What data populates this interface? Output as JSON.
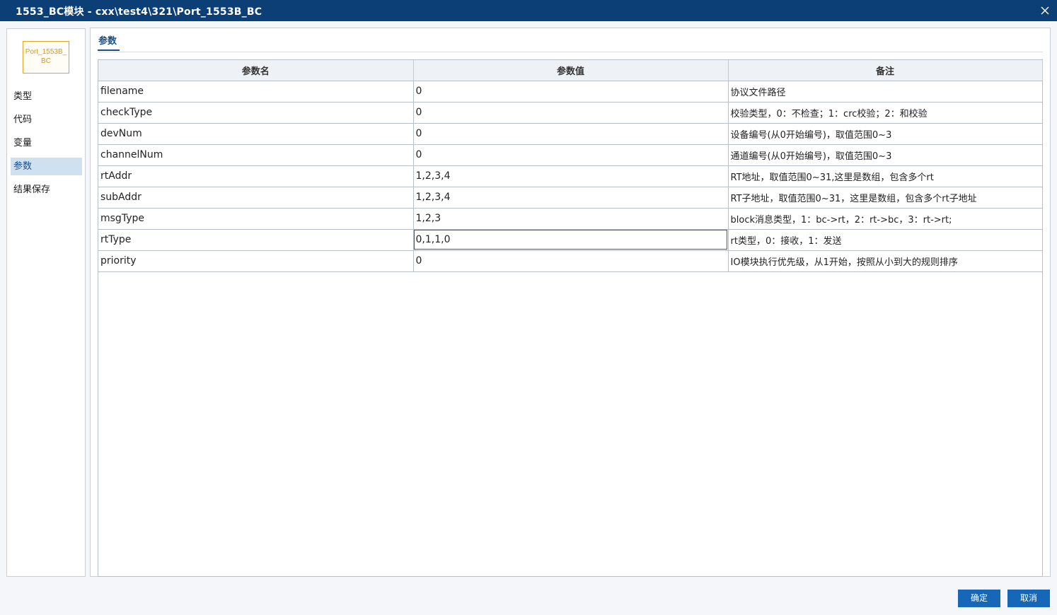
{
  "window": {
    "title": "1553_BC模块 - cxx\\test4\\321\\Port_1553B_BC"
  },
  "sidebar": {
    "module_label": "Port_1553B_BC",
    "items": [
      {
        "label": "类型"
      },
      {
        "label": "代码"
      },
      {
        "label": "变量"
      },
      {
        "label": "参数"
      },
      {
        "label": "结果保存"
      }
    ],
    "active_index": 3
  },
  "main": {
    "tab_label": "参数",
    "table": {
      "headers": [
        "参数名",
        "参数值",
        "备注"
      ],
      "rows": [
        {
          "name": "filename",
          "value": "0",
          "note": "协议文件路径"
        },
        {
          "name": "checkType",
          "value": "0",
          "note": "校验类型，0：不检查；1：crc校验；2：和校验"
        },
        {
          "name": "devNum",
          "value": "0",
          "note": "设备编号(从0开始编号)，取值范围0~3"
        },
        {
          "name": "channelNum",
          "value": "0",
          "note": "通道编号(从0开始编号)，取值范围0~3"
        },
        {
          "name": "rtAddr",
          "value": "1,2,3,4",
          "note": "RT地址，取值范围0~31,这里是数组，包含多个rt"
        },
        {
          "name": "subAddr",
          "value": "1,2,3,4",
          "note": "RT子地址，取值范围0~31，这里是数组，包含多个rt子地址"
        },
        {
          "name": "msgType",
          "value": "1,2,3",
          "note": "block消息类型，1：bc->rt，2：rt->bc，3：rt->rt;"
        },
        {
          "name": "rtType",
          "value": "0,1,1,0",
          "note": "rt类型，0：接收，1：发送"
        },
        {
          "name": "priority",
          "value": "0",
          "note": "IO模块执行优先级，从1开始，按照从小到大的规则排序"
        }
      ]
    }
  },
  "footer": {
    "ok_label": "确定",
    "cancel_label": "取消"
  },
  "colors": {
    "titlebar": "#0d3f77",
    "accent": "#1b4f86",
    "button": "#1667b8",
    "module_border": "#e2a526",
    "active_nav": "#cfe0f1"
  }
}
